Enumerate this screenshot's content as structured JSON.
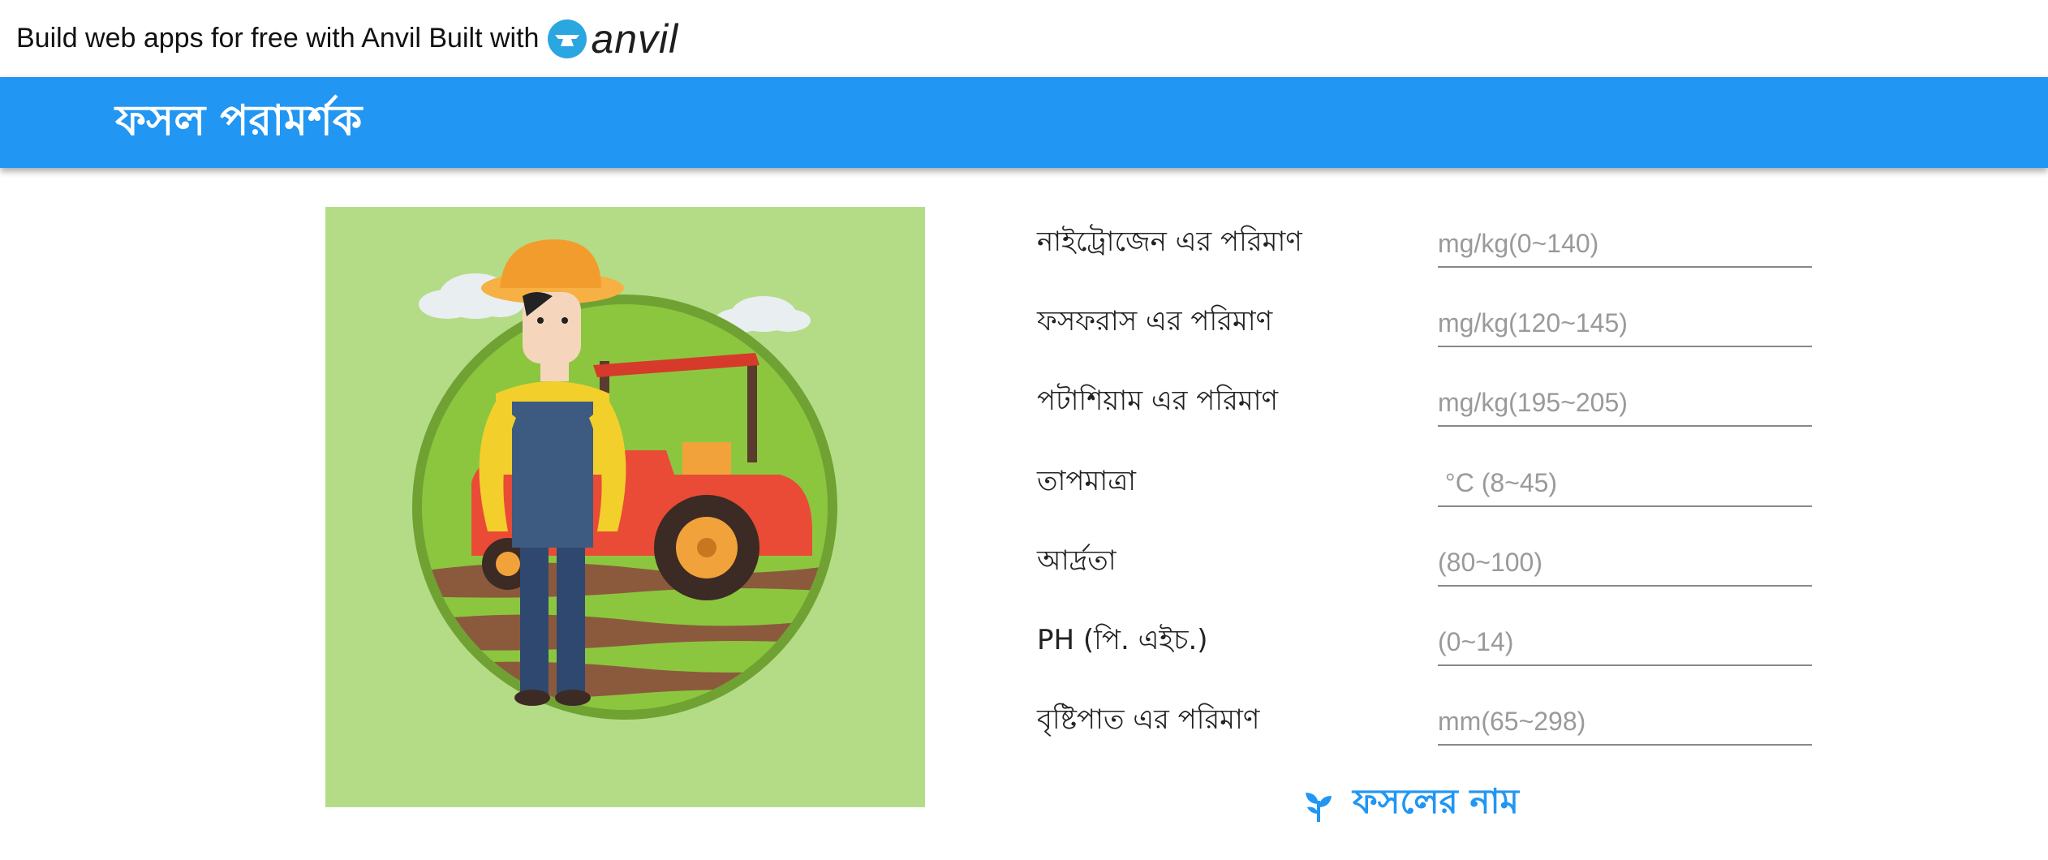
{
  "banner": {
    "text": "Build web apps for free with Anvil Built with",
    "logo_text": "anvil",
    "logo_icon": "anvil-logo-icon"
  },
  "header": {
    "title": "ফসল পরামর্শক"
  },
  "illustration": {
    "description_icon": "farmer-with-tractor-illustration"
  },
  "form": {
    "fields": [
      {
        "label": "নাইট্রোজেন এর পরিমাণ",
        "placeholder": "mg/kg(0~140)",
        "value": ""
      },
      {
        "label": "ফসফরাস এর পরিমাণ",
        "placeholder": "mg/kg(120~145)",
        "value": ""
      },
      {
        "label": "পটাশিয়াম এর পরিমাণ",
        "placeholder": "mg/kg(195~205)",
        "value": ""
      },
      {
        "label": "তাপমাত্রা",
        "placeholder": " °C (8~45)",
        "value": ""
      },
      {
        "label": "আর্দ্রতা",
        "placeholder": "(80~100)",
        "value": ""
      },
      {
        "label": "PH (পি. এইচ.)",
        "placeholder": "(0~14)",
        "value": ""
      },
      {
        "label": "বৃষ্টিপাত এর পরিমাণ",
        "placeholder": "mm(65~298)",
        "value": ""
      }
    ],
    "submit_label": "ফসলের নাম",
    "submit_icon": "sprout-icon"
  },
  "colors": {
    "header": "#2196f3",
    "accent": "#2196f3",
    "illustration_bg": "#b4dc87"
  }
}
